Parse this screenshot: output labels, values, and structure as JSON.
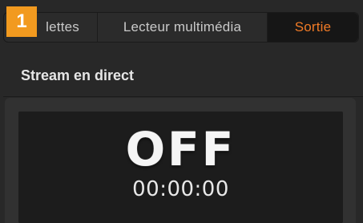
{
  "badge": {
    "number": "1",
    "color": "#f29a1f"
  },
  "tabs": [
    {
      "label": "lettes"
    },
    {
      "label": "Lecteur multimédia"
    },
    {
      "label": "Sortie",
      "active": true,
      "active_color": "#f07a26"
    }
  ],
  "section": {
    "title": "Stream en direct"
  },
  "stream": {
    "status": "OFF",
    "timer": "00:00:00"
  }
}
